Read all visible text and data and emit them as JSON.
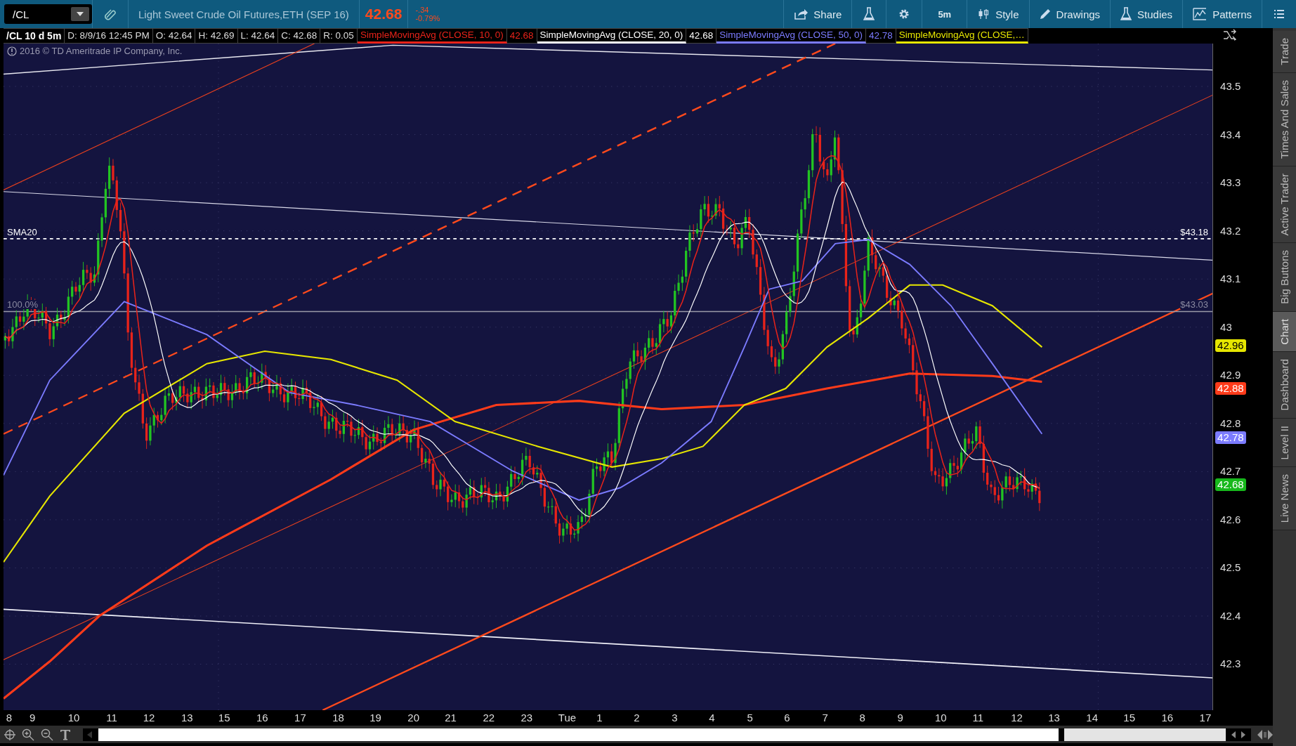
{
  "toolbar": {
    "symbol": "/CL",
    "description": "Light Sweet Crude Oil Futures,ETH (SEP 16)",
    "last": "42.68",
    "change": "-.34",
    "change_pct": "-0.79%",
    "buttons": [
      {
        "kind": "share",
        "label": "Share"
      },
      {
        "kind": "flask"
      },
      {
        "kind": "gear"
      },
      {
        "kind": "text",
        "label": "5m"
      },
      {
        "kind": "style",
        "label": "Style"
      },
      {
        "kind": "drawings",
        "label": "Drawings"
      },
      {
        "kind": "studies",
        "label": "Studies"
      },
      {
        "kind": "patterns",
        "label": "Patterns"
      },
      {
        "kind": "menu"
      }
    ]
  },
  "info_bar": {
    "title": "/CL 10 d 5m",
    "fields": [
      "D: 8/9/16 12:45 PM",
      "O: 42.64",
      "H: 42.69",
      "L: 42.64",
      "C: 42.68",
      "R: 0.05"
    ],
    "studies": [
      {
        "name": "SimpleMovingAvg (CLOSE, 10, 0)",
        "value": "42.68",
        "color": "#e8231a"
      },
      {
        "name": "SimpleMovingAvg (CLOSE, 20, 0)",
        "value": "42.68",
        "color": "#ffffff"
      },
      {
        "name": "SimpleMovingAvg (CLOSE, 50, 0)",
        "value": "42.78",
        "color": "#7b7bff"
      },
      {
        "name": "SimpleMovingAvg (CLOSE,…",
        "color": "#e6e600"
      }
    ]
  },
  "chart": {
    "copyright": "2016 © TD Ameritrade IP Company, Inc.",
    "levels": [
      {
        "kind": "dotted",
        "label": "SMA20",
        "price_label": "$43.18"
      },
      {
        "kind": "solid",
        "label": "100.0%",
        "price_label": "$43.03"
      }
    ],
    "price_ticks": [
      "43.5",
      "43.4",
      "43.3",
      "43.2",
      "43.1",
      "43",
      "42.9",
      "42.8",
      "42.7",
      "42.6",
      "42.5",
      "42.4",
      "42.3"
    ],
    "price_badges": [
      {
        "value": "42.96",
        "color": "#e6e600"
      },
      {
        "value": "42.88",
        "color": "#ff3b1a"
      },
      {
        "value": "42.78",
        "color": "#7b7bff"
      },
      {
        "value": "42.68",
        "color": "#17b81c"
      }
    ],
    "time_labels": [
      "8",
      "9",
      "10",
      "11",
      "12",
      "13",
      "15",
      "16",
      "17",
      "18",
      "19",
      "20",
      "21",
      "22",
      "23",
      "Tue",
      "1",
      "2",
      "3",
      "4",
      "5",
      "6",
      "7",
      "8",
      "9",
      "10",
      "11",
      "12",
      "13",
      "14",
      "15",
      "16",
      "17"
    ]
  },
  "sidebar_tabs": [
    {
      "label": "Trade",
      "selected": false
    },
    {
      "label": "Times And Sales",
      "selected": false
    },
    {
      "label": "Active Trader",
      "selected": false
    },
    {
      "label": "Big Buttons",
      "selected": false
    },
    {
      "label": "Chart",
      "selected": true
    },
    {
      "label": "Dashboard",
      "selected": false
    },
    {
      "label": "Level II",
      "selected": false
    },
    {
      "label": "Live News",
      "selected": false
    }
  ]
}
